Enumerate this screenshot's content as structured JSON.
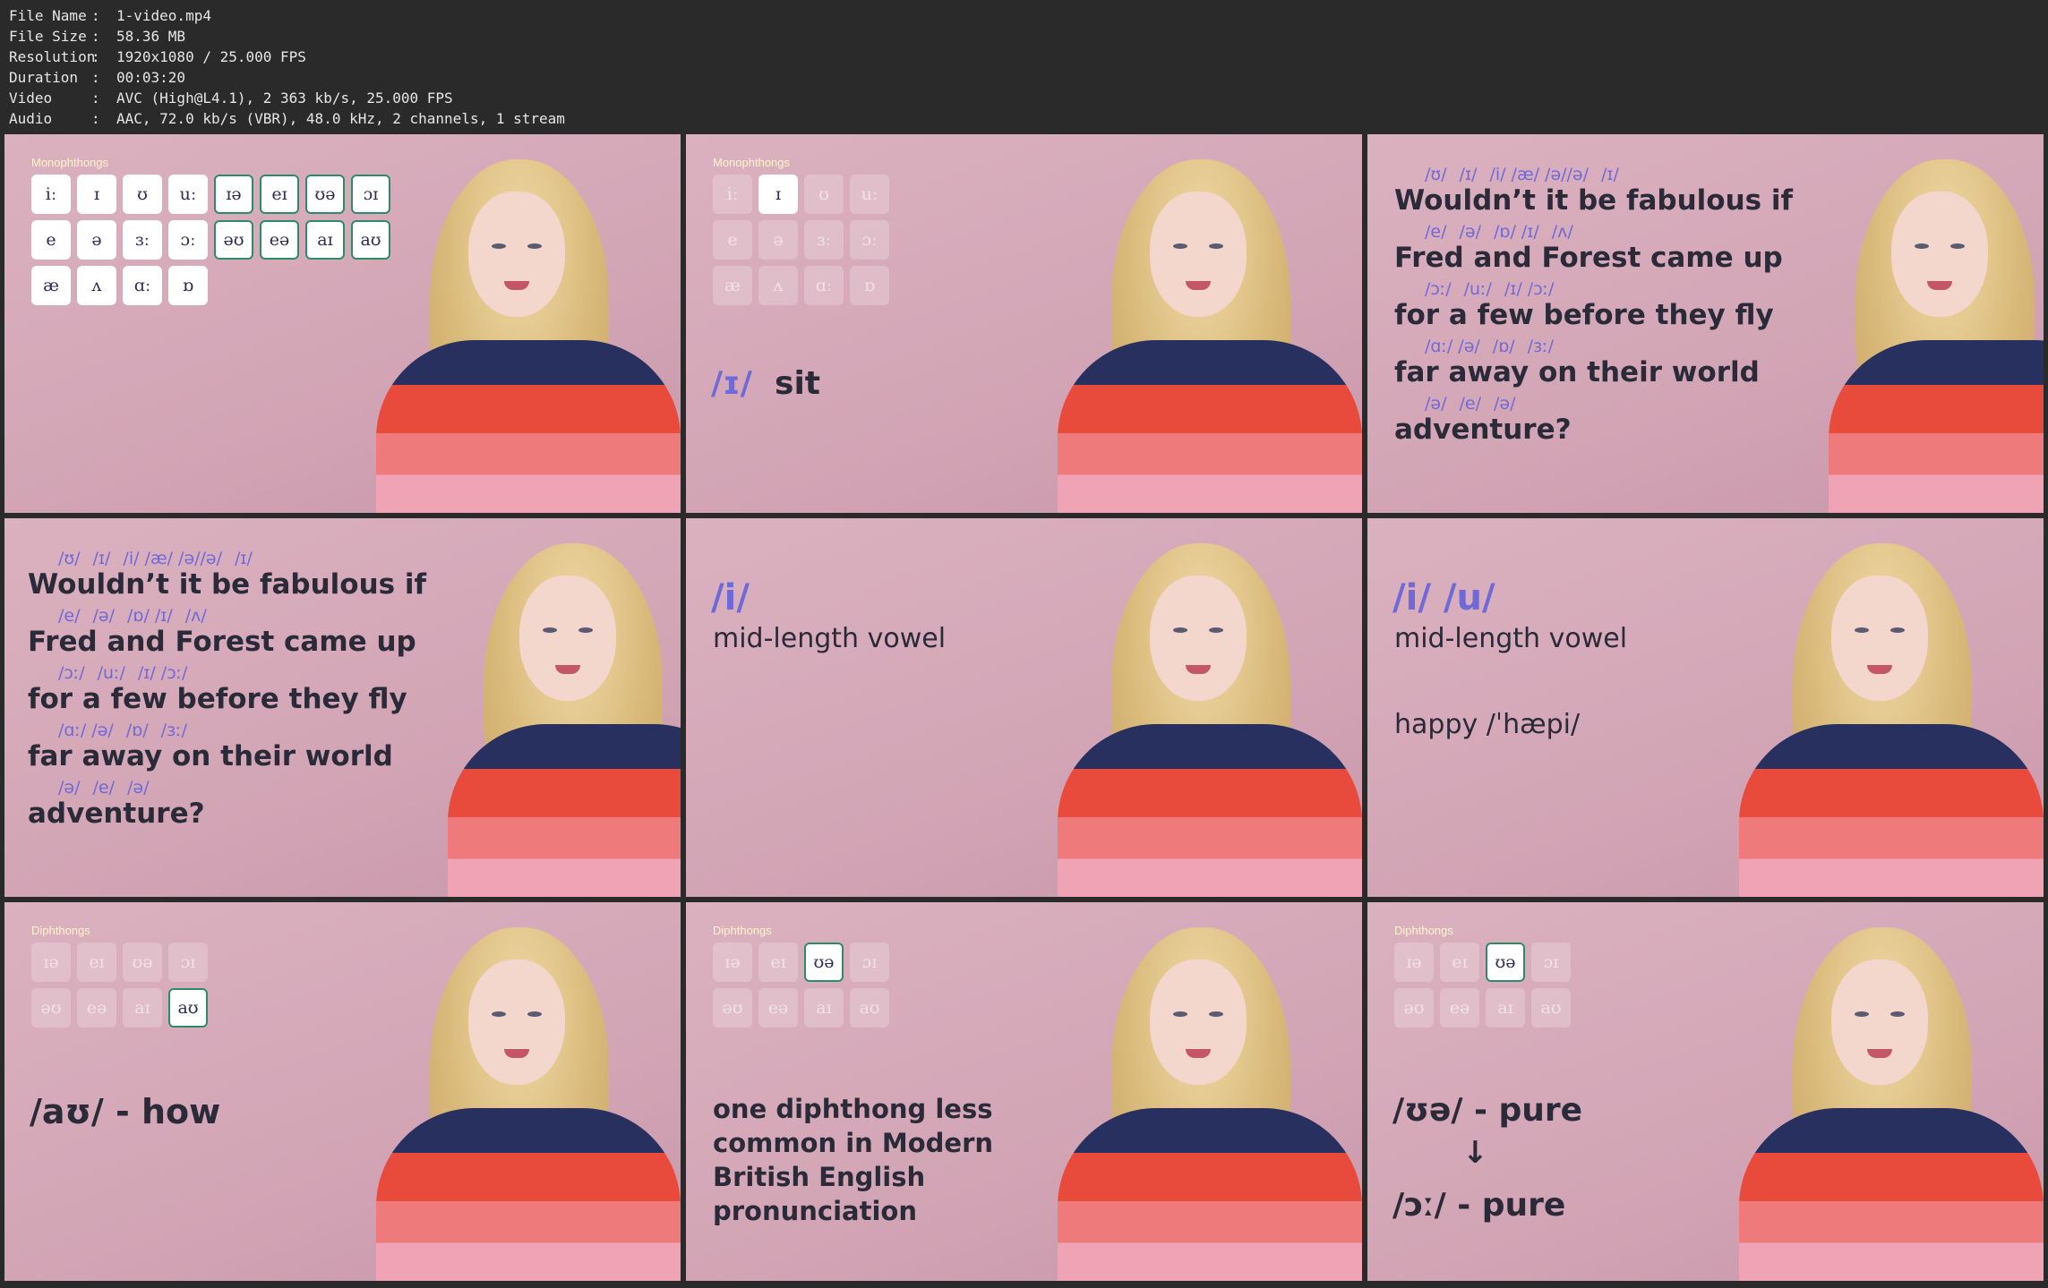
{
  "metadata": [
    {
      "key": "File Name",
      "value": "1-video.mp4"
    },
    {
      "key": "File Size",
      "value": "58.36 MB"
    },
    {
      "key": "Resolution",
      "value": "1920x1080 / 25.000 FPS"
    },
    {
      "key": "Duration",
      "value": "00:03:20"
    },
    {
      "key": "Video",
      "value": "AVC (High@L4.1), 2 363 kb/s, 25.000 FPS"
    },
    {
      "key": "Audio",
      "value": "AAC, 72.0 kb/s (VBR), 48.0 kHz, 2 channels, 1 stream"
    }
  ],
  "separator": ":",
  "colors": {
    "accent": "#6f6ad8",
    "text": "#2a2a38",
    "heading": "#fff5c9",
    "tile_border": "#2e8b68",
    "background": "#d3a6b6"
  },
  "monophthongs_heading": "Monophthongs",
  "diphthongs_heading": "Diphthongs",
  "frame1_tiles": [
    [
      "iː",
      "ɪ",
      "ʊ",
      "uː",
      "ɪə",
      "eɪ",
      "ʊə",
      "ɔɪ"
    ],
    [
      "e",
      "ə",
      "ɜː",
      "ɔː",
      "əʊ",
      "eə",
      "aɪ",
      "aʊ"
    ],
    [
      "æ",
      "ʌ",
      "ɑː",
      "ɒ"
    ]
  ],
  "frame2": {
    "tiles": [
      [
        "iː",
        "ɪ",
        "ʊ",
        "uː"
      ],
      [
        "e",
        "ə",
        "ɜː",
        "ɔː"
      ],
      [
        "æ",
        "ʌ",
        "ɑː",
        "ɒ"
      ]
    ],
    "symbol": "/ɪ/",
    "word": "sit"
  },
  "poem": {
    "lines": [
      {
        "ipa": [
          "/ʊ/",
          "/ɪ/",
          "/i/ /æ/ /ə//ə/",
          "/ɪ/"
        ],
        "text": "Wouldn’t it be fabulous if"
      },
      {
        "ipa": [
          "/e/",
          "/ə/",
          "/ɒ/ /ɪ/",
          "/ʌ/"
        ],
        "text": "Fred and Forest came up"
      },
      {
        "ipa": [
          "/ɔː/",
          "/uː/",
          "/ɪ/ /ɔː/"
        ],
        "text": "for a few before they fly"
      },
      {
        "ipa": [
          "/ɑː/ /ə/",
          "/ɒ/",
          "/ɜː/"
        ],
        "text": "far away on their world"
      },
      {
        "ipa": [
          "/ə/",
          "/e/",
          "/ə/"
        ],
        "text": "adventure?"
      }
    ]
  },
  "frame5": {
    "symbol": "/i/",
    "caption": "mid-length vowel"
  },
  "frame6": {
    "symbol": "/i/ /u/",
    "caption": "mid-length vowel",
    "example": "happy /ˈhæpi/"
  },
  "diphthong_tiles": [
    [
      "ɪə",
      "eɪ",
      "ʊə",
      "ɔɪ"
    ],
    [
      "əʊ",
      "eə",
      "aɪ",
      "aʊ"
    ]
  ],
  "frame7": {
    "label": "/aʊ/ - how"
  },
  "frame8": {
    "caption_lines": [
      "one diphthong less",
      "common in Modern",
      "British English",
      "pronunciation"
    ]
  },
  "frame9": {
    "line1": "/ʊə/ - pure",
    "arrow": "↓",
    "line2": "/ɔː/ - pure"
  }
}
